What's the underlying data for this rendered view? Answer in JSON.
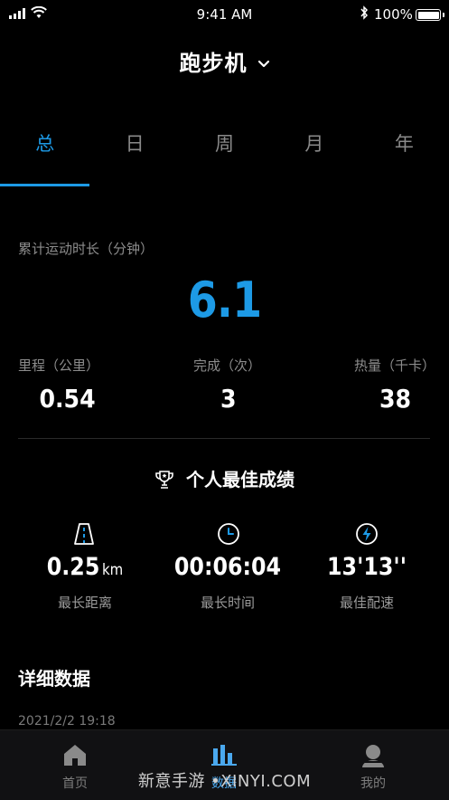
{
  "status_bar": {
    "time": "9:41 AM",
    "battery": "100%"
  },
  "header": {
    "title": "跑步机"
  },
  "tabs": [
    {
      "label": "总"
    },
    {
      "label": "日"
    },
    {
      "label": "周"
    },
    {
      "label": "月"
    },
    {
      "label": "年"
    }
  ],
  "summary": {
    "duration_label": "累计运动时长（分钟）",
    "duration_value": "6.1",
    "stats": [
      {
        "label": "里程（公里）",
        "value": "0.54"
      },
      {
        "label": "完成（次）",
        "value": "3"
      },
      {
        "label": "热量（千卡）",
        "value": "38"
      }
    ]
  },
  "best": {
    "title": "个人最佳成绩",
    "items": [
      {
        "value": "0.25",
        "unit": "km",
        "label": "最长距离",
        "icon": "road-icon"
      },
      {
        "value": "00:06:04",
        "unit": "",
        "label": "最长时间",
        "icon": "clock-icon"
      },
      {
        "value": "13'13''",
        "unit": "",
        "label": "最佳配速",
        "icon": "lightning-icon"
      }
    ]
  },
  "detail": {
    "title": "详细数据",
    "date": "2021/2/2 19:18"
  },
  "bottom_nav": [
    {
      "label": "首页",
      "icon": "home-icon"
    },
    {
      "label": "数据",
      "icon": "chart-icon"
    },
    {
      "label": "我的",
      "icon": "profile-icon"
    }
  ],
  "watermark": "新意手游 •XINYI.COM",
  "colors": {
    "accent": "#1d9ae6",
    "background": "#000000",
    "muted": "#8c8c8c"
  }
}
